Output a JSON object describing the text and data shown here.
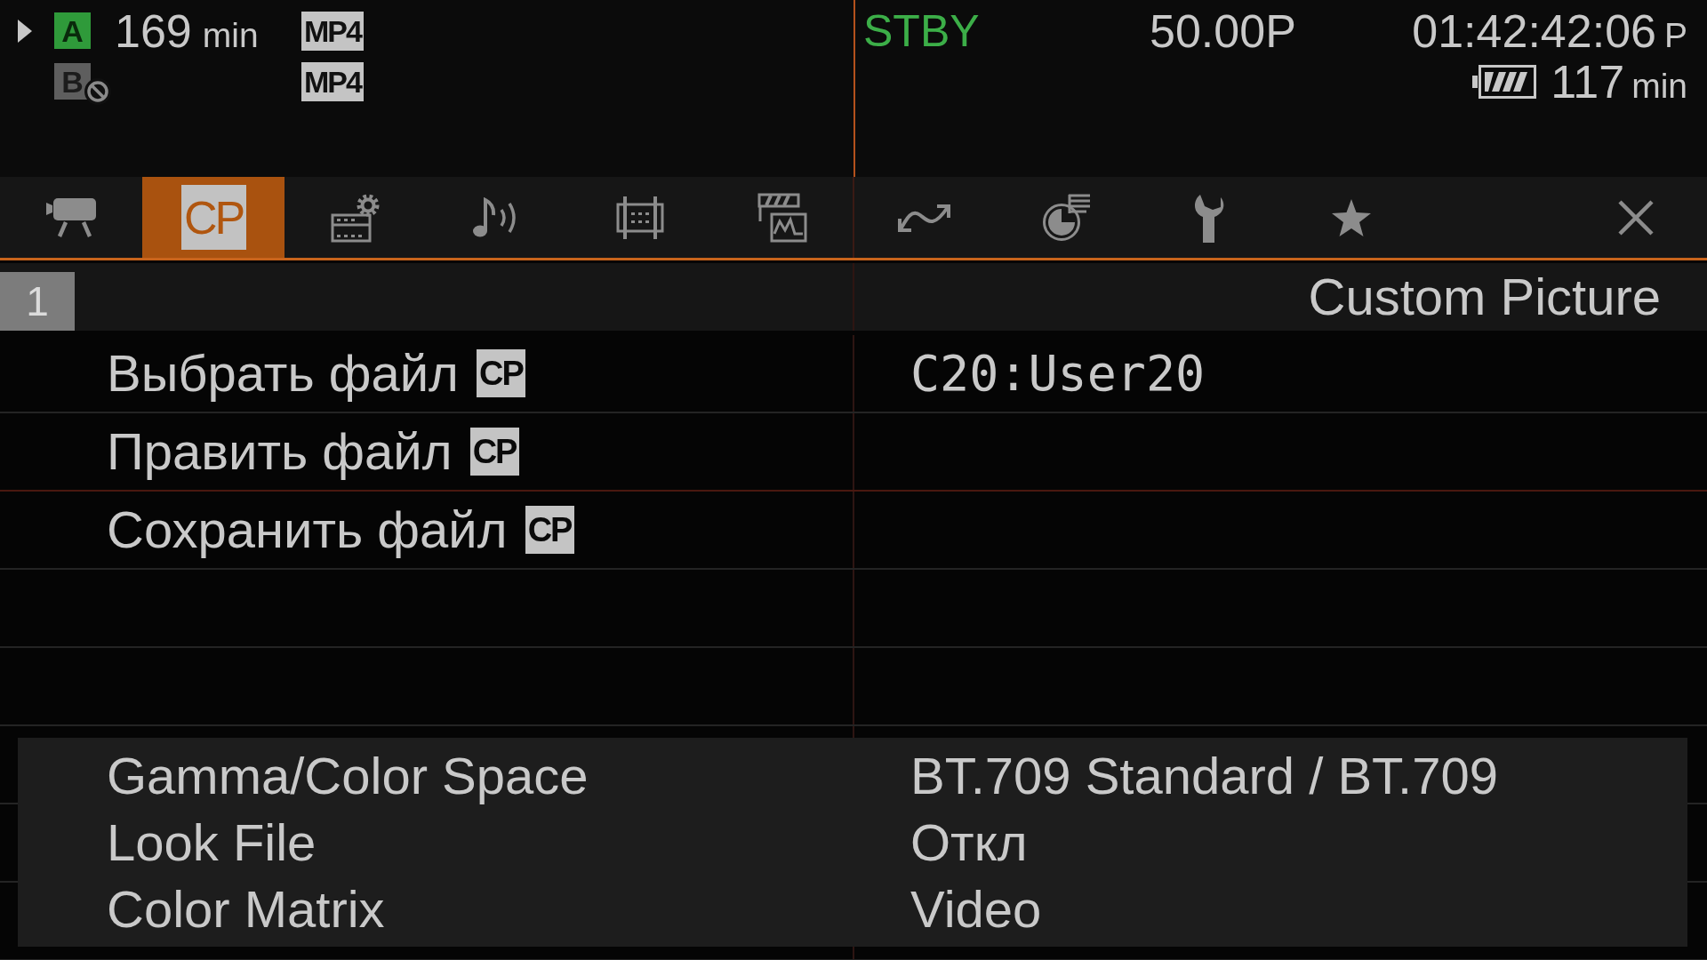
{
  "status_bar": {
    "media": [
      {
        "slot": "A",
        "selected": true,
        "available": true,
        "remaining": "169",
        "unit": "min",
        "format": "MP4"
      },
      {
        "slot": "B",
        "selected": false,
        "available": false,
        "format": "MP4"
      }
    ],
    "mode": "STBY",
    "frame_rate": "50.00P",
    "timecode": "01:42:42:06",
    "timecode_mode": "P",
    "battery": {
      "remaining": "117",
      "unit": "min"
    }
  },
  "tabs": [
    {
      "kind": "camera",
      "selected": false
    },
    {
      "kind": "text",
      "label": "CP",
      "selected": true
    },
    {
      "kind": "film-gear",
      "selected": false
    },
    {
      "kind": "audio",
      "selected": false
    },
    {
      "kind": "film-frame",
      "selected": false
    },
    {
      "kind": "clapper",
      "selected": false
    },
    {
      "kind": "wave",
      "selected": false
    },
    {
      "kind": "pie",
      "selected": false
    },
    {
      "kind": "wrench",
      "selected": false
    },
    {
      "kind": "star",
      "selected": false
    }
  ],
  "menu": {
    "page": "1",
    "title": "Custom Picture",
    "items": [
      {
        "label": "Выбрать файл",
        "badge": "CP",
        "value": "C20:User20",
        "selected": false
      },
      {
        "label": "Править файл",
        "badge": "CP",
        "selected": true
      },
      {
        "label": "Сохранить файл",
        "badge": "CP",
        "selected": false
      }
    ]
  },
  "summary": [
    {
      "label": "Gamma/Color Space",
      "value": "BT.709 Standard / BT.709"
    },
    {
      "label": "Look File",
      "value": "Откл"
    },
    {
      "label": "Color Matrix",
      "value": "Video"
    }
  ]
}
